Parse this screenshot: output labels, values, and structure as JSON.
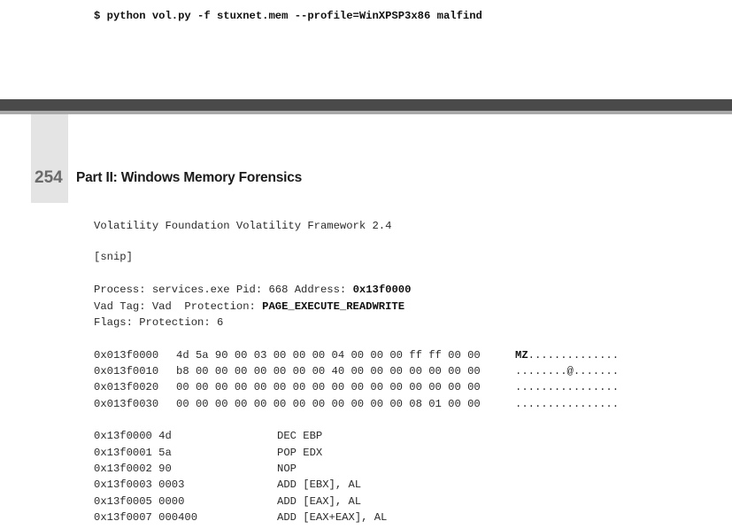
{
  "top_command": "$ python vol.py -f stuxnet.mem --profile=WinXPSP3x86 malfind",
  "header": {
    "page_number": "254",
    "part_title": "Part II: Windows Memory Forensics"
  },
  "output": {
    "banner": "Volatility Foundation Volatility Framework 2.4",
    "snip": "[snip]",
    "process_line": {
      "prefix": "Process: services.exe Pid: 668 Address: ",
      "address": "0x13f0000"
    },
    "vad_line": {
      "prefix": "Vad Tag: Vad  Protection: ",
      "protection": "PAGE_EXECUTE_READWRITE"
    },
    "flags_line": "Flags: Protection: 6",
    "hexdump": [
      {
        "address": "0x013f0000",
        "bytes": "4d 5a 90 00 03 00 00 00 04 00 00 00 ff ff 00 00",
        "ascii_bold": "MZ",
        "ascii_rest": ".............."
      },
      {
        "address": "0x013f0010",
        "bytes": "b8 00 00 00 00 00 00 00 40 00 00 00 00 00 00 00",
        "ascii_bold": "",
        "ascii_rest": "........@......."
      },
      {
        "address": "0x013f0020",
        "bytes": "00 00 00 00 00 00 00 00 00 00 00 00 00 00 00 00",
        "ascii_bold": "",
        "ascii_rest": "................"
      },
      {
        "address": "0x013f0030",
        "bytes": "00 00 00 00 00 00 00 00 00 00 00 00 08 01 00 00",
        "ascii_bold": "",
        "ascii_rest": "................"
      }
    ],
    "disassembly": [
      {
        "address": "0x13f0000",
        "bytes": "4d",
        "instruction": "DEC EBP"
      },
      {
        "address": "0x13f0001",
        "bytes": "5a",
        "instruction": "POP EDX"
      },
      {
        "address": "0x13f0002",
        "bytes": "90",
        "instruction": "NOP"
      },
      {
        "address": "0x13f0003",
        "bytes": "0003",
        "instruction": "ADD [EBX], AL"
      },
      {
        "address": "0x13f0005",
        "bytes": "0000",
        "instruction": "ADD [EAX], AL"
      },
      {
        "address": "0x13f0007",
        "bytes": "000400",
        "instruction": "ADD [EAX+EAX], AL"
      }
    ]
  }
}
